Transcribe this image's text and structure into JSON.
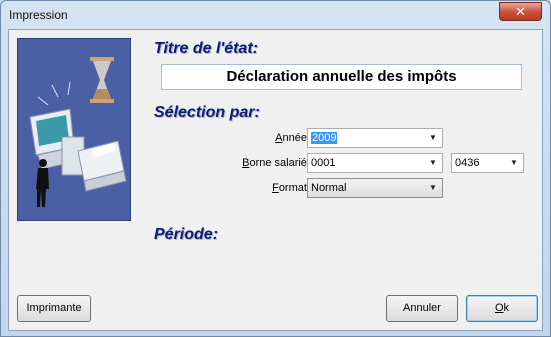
{
  "window": {
    "title": "Impression",
    "close_glyph": "✕"
  },
  "report_section": {
    "title": "Titre de l'état:",
    "value": "Déclaration annuelle des impôts"
  },
  "selection_section": {
    "title": "Sélection par:",
    "year": {
      "label_pre": "",
      "label_u": "A",
      "label_post": "nnée:",
      "value": "2009"
    },
    "employee_range": {
      "label_pre": "",
      "label_u": "B",
      "label_post": "orne salarié:",
      "from": "0001",
      "to": "0436"
    },
    "format": {
      "label_pre": "",
      "label_u": "F",
      "label_post": "ormat:",
      "value": "Normal"
    }
  },
  "period_section": {
    "title": "Période:"
  },
  "buttons": {
    "printer": "Imprimante",
    "cancel": "Annuler",
    "ok_pre": "",
    "ok_u": "O",
    "ok_post": "k"
  },
  "icons": {
    "dropdown": "chevron-down-icon",
    "illustration": "computer-hourglass-illustration"
  },
  "colors": {
    "section_title": "#101a6e",
    "illustration_bg": "#4b5fa5",
    "selection": "#3399ff"
  }
}
